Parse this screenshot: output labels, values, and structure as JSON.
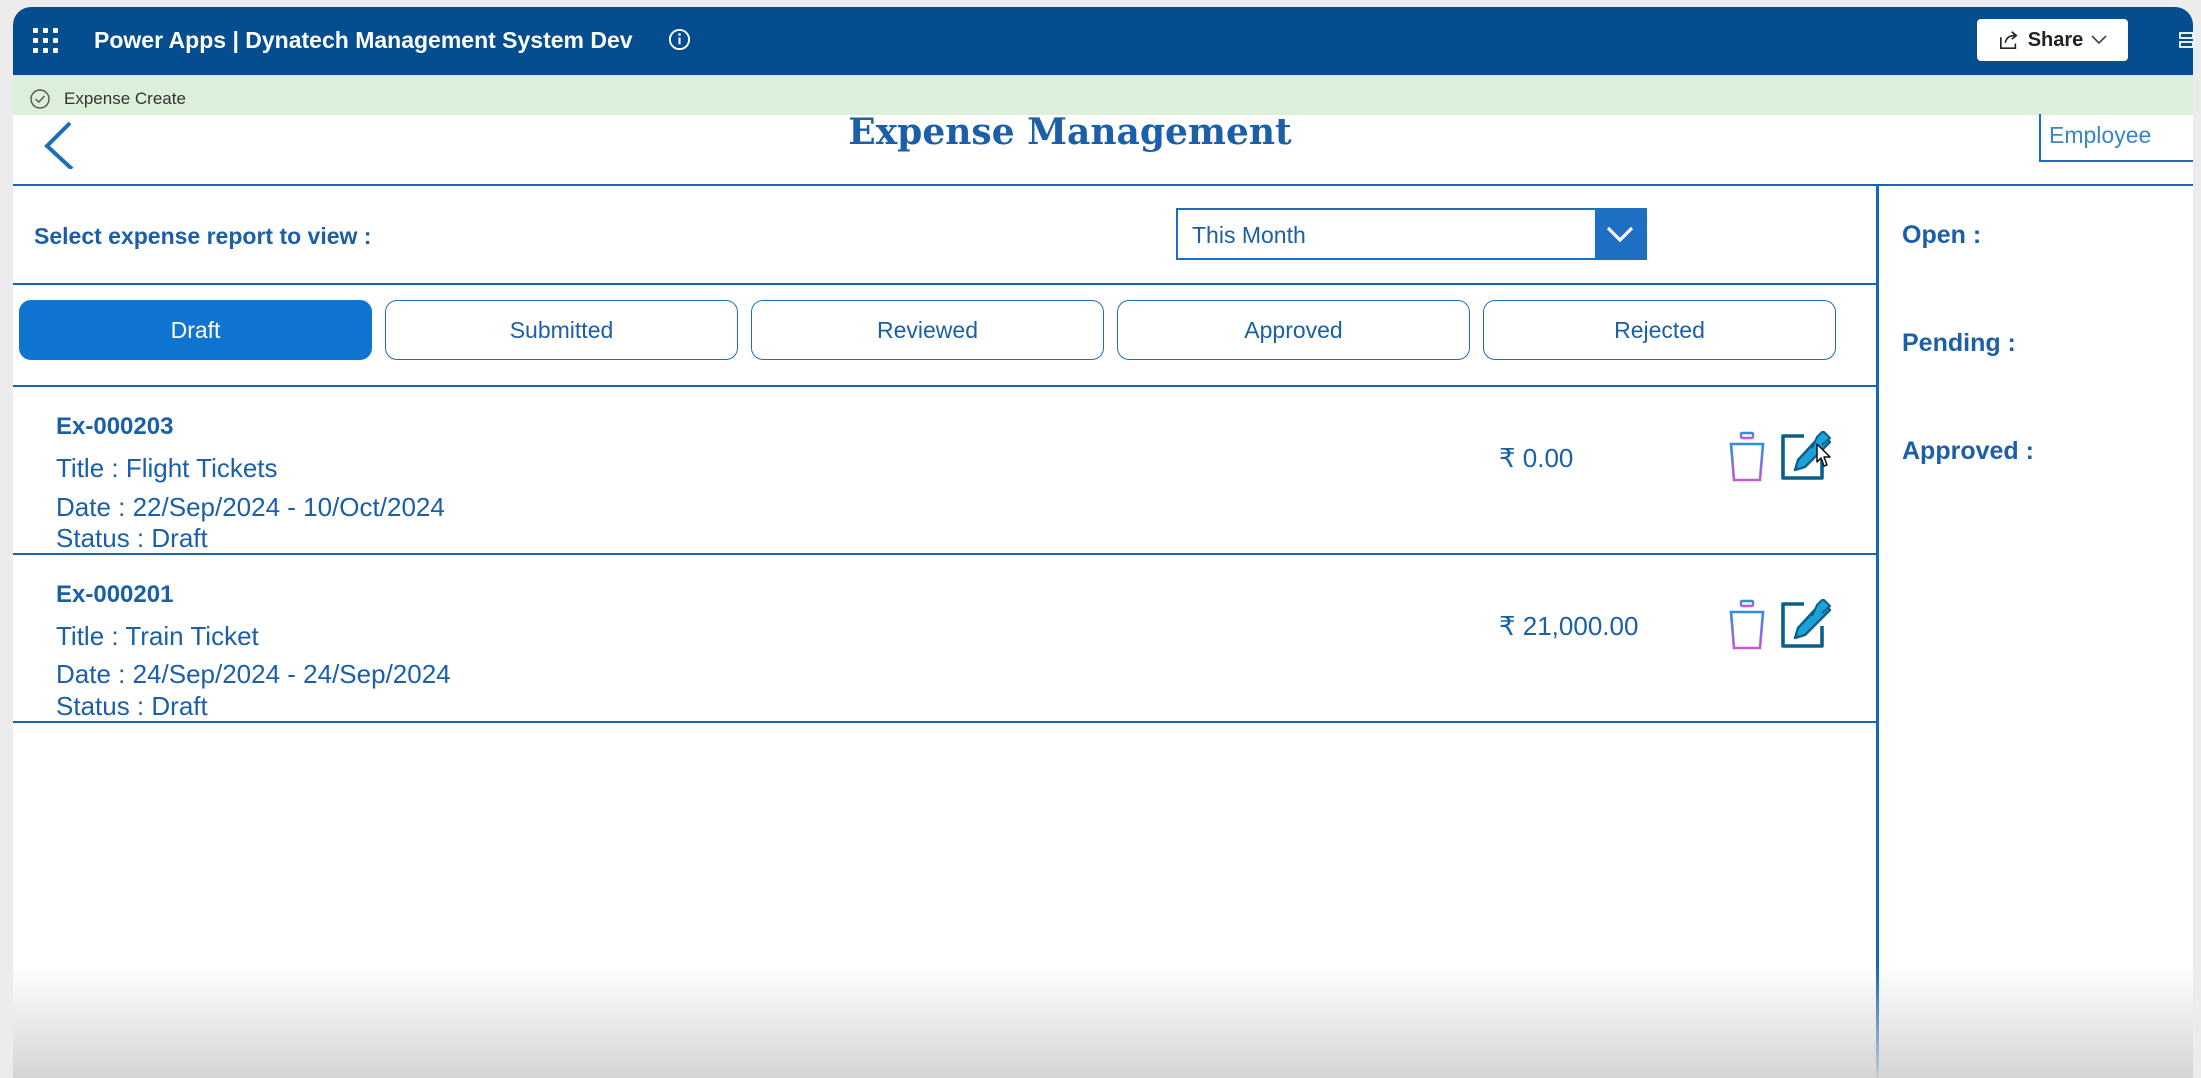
{
  "topbar": {
    "app_title": "Power Apps  |  Dynatech Management System Dev",
    "share_label": "Share"
  },
  "notification": {
    "text": "Expense Create"
  },
  "header": {
    "title": "Expense Management",
    "employee_tab": "Employee"
  },
  "filter": {
    "label": "Select expense report to view :",
    "selected": "This Month"
  },
  "tabs": [
    {
      "label": "Draft"
    },
    {
      "label": "Submitted"
    },
    {
      "label": "Reviewed"
    },
    {
      "label": "Approved"
    },
    {
      "label": "Rejected"
    }
  ],
  "active_tab": "Draft",
  "expenses": [
    {
      "id": "Ex-000203",
      "title": "Title : Flight Tickets",
      "date": "Date : 22/Sep/2024 - 10/Oct/2024",
      "status": "Status : Draft",
      "amount": "₹ 0.00"
    },
    {
      "id": "Ex-000201",
      "title": "Title : Train Ticket",
      "date": "Date : 24/Sep/2024 - 24/Sep/2024",
      "status": "Status : Draft",
      "amount": "₹ 21,000.00"
    }
  ],
  "summary": {
    "open_label": "Open :",
    "pending_label": "Pending :",
    "approved_label": "Approved :"
  },
  "colors": {
    "brand_bar": "#044d8f",
    "accent": "#1a5fa8",
    "active_tab": "#0f75d1",
    "notification_bg": "#dcefdb",
    "delete_icon_gradient": [
      "#2a8fe0",
      "#c25bd6"
    ]
  },
  "icons": {
    "app_launcher": "waffle-icon",
    "info": "info-icon",
    "share": "share-icon",
    "notification": "check-circle-icon",
    "back": "chevron-left-icon",
    "dropdown": "chevron-down-icon",
    "delete": "trash-icon",
    "edit": "edit-icon"
  }
}
